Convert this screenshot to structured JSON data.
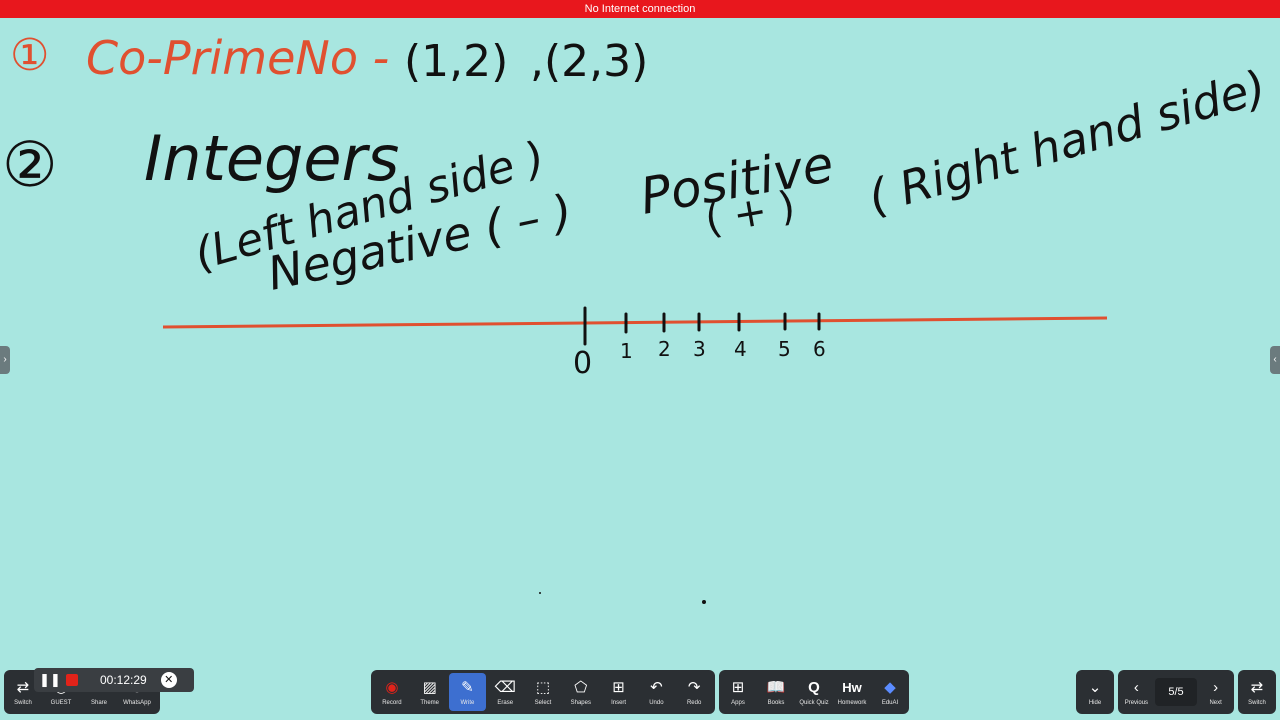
{
  "status_bar": {
    "text": "No Internet connection",
    "color": "#e8171d"
  },
  "board": {
    "background": "#a8e6e0",
    "line1": {
      "bullet": "①",
      "title": "Co-PrimeNo -",
      "pair1": "(1,2)",
      "pair2": ",(2,3)"
    },
    "line2": {
      "bullet": "②",
      "heading": "Integers",
      "left_side": "(Left hand side )",
      "negative": "Negative ( – )",
      "positive": "Positive",
      "plus": "( + )",
      "right_side": "( Right hand side)"
    },
    "number_line": {
      "labels": [
        "0",
        "1",
        "2",
        "3",
        "4",
        "5",
        "6"
      ]
    }
  },
  "recording": {
    "pause_icon": "pause-icon",
    "timer": "00:12:29",
    "close_icon": "close-icon"
  },
  "left_toolbar": {
    "items": [
      {
        "label": "Switch",
        "icon": "⇄"
      },
      {
        "label": "GUEST",
        "icon": "◉"
      },
      {
        "label": "Share",
        "icon": "⇪"
      },
      {
        "label": "WhatsApp",
        "icon": "✆"
      }
    ]
  },
  "main_toolbar": {
    "items": [
      {
        "label": "Record",
        "icon": "◉"
      },
      {
        "label": "Theme",
        "icon": "▨"
      },
      {
        "label": "Write",
        "icon": "✎"
      },
      {
        "label": "Erase",
        "icon": "⌫"
      },
      {
        "label": "Select",
        "icon": "⬚"
      },
      {
        "label": "Shapes",
        "icon": "⬠"
      },
      {
        "label": "Insert",
        "icon": "⊞"
      },
      {
        "label": "Undo",
        "icon": "↶"
      },
      {
        "label": "Redo",
        "icon": "↷"
      }
    ],
    "active": "Write",
    "record_color": "#e2231a",
    "active_color": "#3d6fd0"
  },
  "apps_toolbar": {
    "items": [
      {
        "label": "Apps",
        "icon": "⊞"
      },
      {
        "label": "Books",
        "icon": "📖"
      },
      {
        "label": "Quick Quiz",
        "icon": "Q"
      },
      {
        "label": "Homework",
        "icon": "Hw"
      },
      {
        "label": "EduAI",
        "icon": "◆"
      }
    ]
  },
  "right_toolbar": {
    "hide": {
      "label": "Hide",
      "icon": "⌄"
    },
    "previous": {
      "label": "Previous",
      "icon": "‹"
    },
    "page": "5/5",
    "next": {
      "label": "Next",
      "icon": "›"
    },
    "switch": {
      "label": "Switch",
      "icon": "⇄"
    }
  },
  "side_tabs": {
    "left_icon": "›",
    "right_icon": "‹"
  }
}
